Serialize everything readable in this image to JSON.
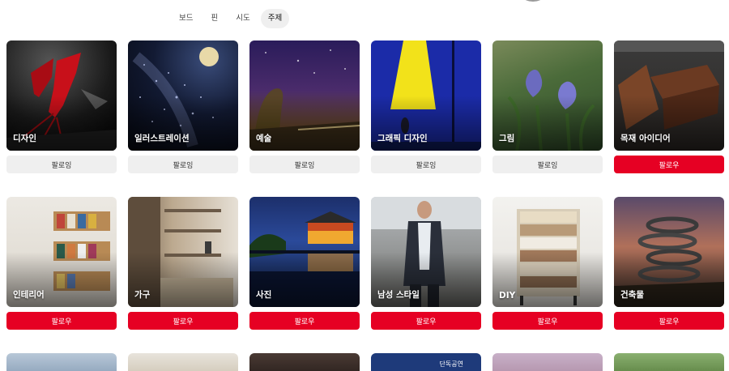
{
  "tabs": [
    {
      "label": "보드",
      "active": false
    },
    {
      "label": "핀",
      "active": false
    },
    {
      "label": "시도",
      "active": false
    },
    {
      "label": "주제",
      "active": true
    }
  ],
  "topics": [
    {
      "label": "디자인",
      "button": "팔로잉",
      "following": true
    },
    {
      "label": "일러스트레이션",
      "button": "팔로잉",
      "following": true
    },
    {
      "label": "예술",
      "button": "팔로잉",
      "following": true
    },
    {
      "label": "그래픽 디자인",
      "button": "팔로잉",
      "following": true
    },
    {
      "label": "그림",
      "button": "팔로잉",
      "following": true
    },
    {
      "label": "목재 아이디어",
      "button": "팔로우",
      "following": false
    },
    {
      "label": "인테리어",
      "button": "팔로우",
      "following": false
    },
    {
      "label": "가구",
      "button": "팔로우",
      "following": false
    },
    {
      "label": "사진",
      "button": "팔로우",
      "following": false
    },
    {
      "label": "남성 스타일",
      "button": "팔로우",
      "following": false
    },
    {
      "label": "DIY",
      "button": "팔로우",
      "following": false
    },
    {
      "label": "건축물",
      "button": "팔로우",
      "following": false
    }
  ],
  "partial_row": {
    "banner_text": "단독공연"
  },
  "colors": {
    "follow": "#e60023",
    "following": "#efefef"
  }
}
